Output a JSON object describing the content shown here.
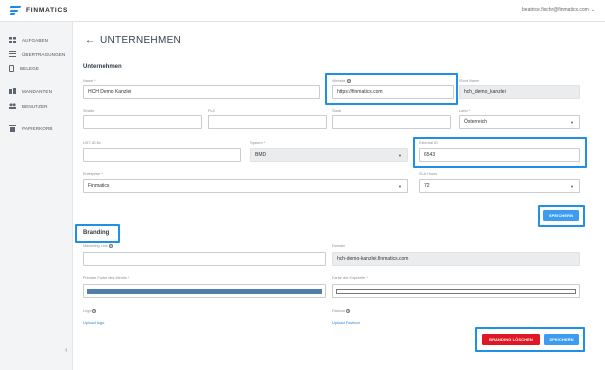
{
  "app": {
    "logo_text": "FINMATICS",
    "user": "beatrice.fischr@finmatics.com",
    "user_caret": "⌄"
  },
  "sidebar": {
    "items": [
      {
        "label": "AUFGABEN",
        "icon": "grid-icon"
      },
      {
        "label": "ÜBERTRAGUNGEN",
        "icon": "list-icon"
      },
      {
        "label": "BELEGE",
        "icon": "document-icon"
      },
      {
        "label": "MANDANTEN",
        "icon": "building-icon"
      },
      {
        "label": "BENUTZER",
        "icon": "users-icon"
      },
      {
        "label": "PAPIERKORB",
        "icon": "trash-icon"
      }
    ],
    "collapse": "‹"
  },
  "header": {
    "back": "←",
    "title": "UNTERNEHMEN"
  },
  "unternehmen": {
    "section_title": "Unternehmen",
    "name": {
      "label": "Name *",
      "value": "HCH Demo Kanzlei"
    },
    "website": {
      "label": "Website",
      "value": "https://finmatics.com"
    },
    "short_name": {
      "label": "Short Name",
      "value": "hch_demo_kanzlei"
    },
    "strasse": {
      "label": "Straße",
      "value": ""
    },
    "plz": {
      "label": "PLZ",
      "value": ""
    },
    "stadt": {
      "label": "Stadt",
      "value": ""
    },
    "land": {
      "label": "Land *",
      "value": "Österreich"
    },
    "ust": {
      "label": "UST-ID-Nr.",
      "value": ""
    },
    "system": {
      "label": "System *",
      "value": "BMD"
    },
    "external_id": {
      "label": "External ID",
      "value": "6543"
    },
    "enterprise": {
      "label": "Enterprise *",
      "value": "Finmatics"
    },
    "sla_hours": {
      "label": "SLA Hours",
      "value": "72"
    },
    "save": "SPEICHERN"
  },
  "branding": {
    "section_title": "Branding",
    "marketing_link": {
      "label": "Marketing Link",
      "value": ""
    },
    "domain": {
      "label": "Domain",
      "value": "hch-demo-kanzlei.finmatics.com"
    },
    "primary_color": {
      "label": "Primäre Farbe des Menüs *",
      "color": "#4f7ea9"
    },
    "header_color": {
      "label": "Farbe der Kopfzeile *",
      "color": "#ffffff"
    },
    "logo": {
      "label": "Logo",
      "upload": "Upload logo"
    },
    "favicon": {
      "label": "Favicon",
      "upload": "Upload Favicon"
    },
    "delete": "BRANDING LÖSCHEN",
    "save": "SPEICHERN"
  },
  "colors": {
    "accent": "#3b9cf0",
    "danger": "#e01823",
    "highlight": "#1e90e8"
  }
}
